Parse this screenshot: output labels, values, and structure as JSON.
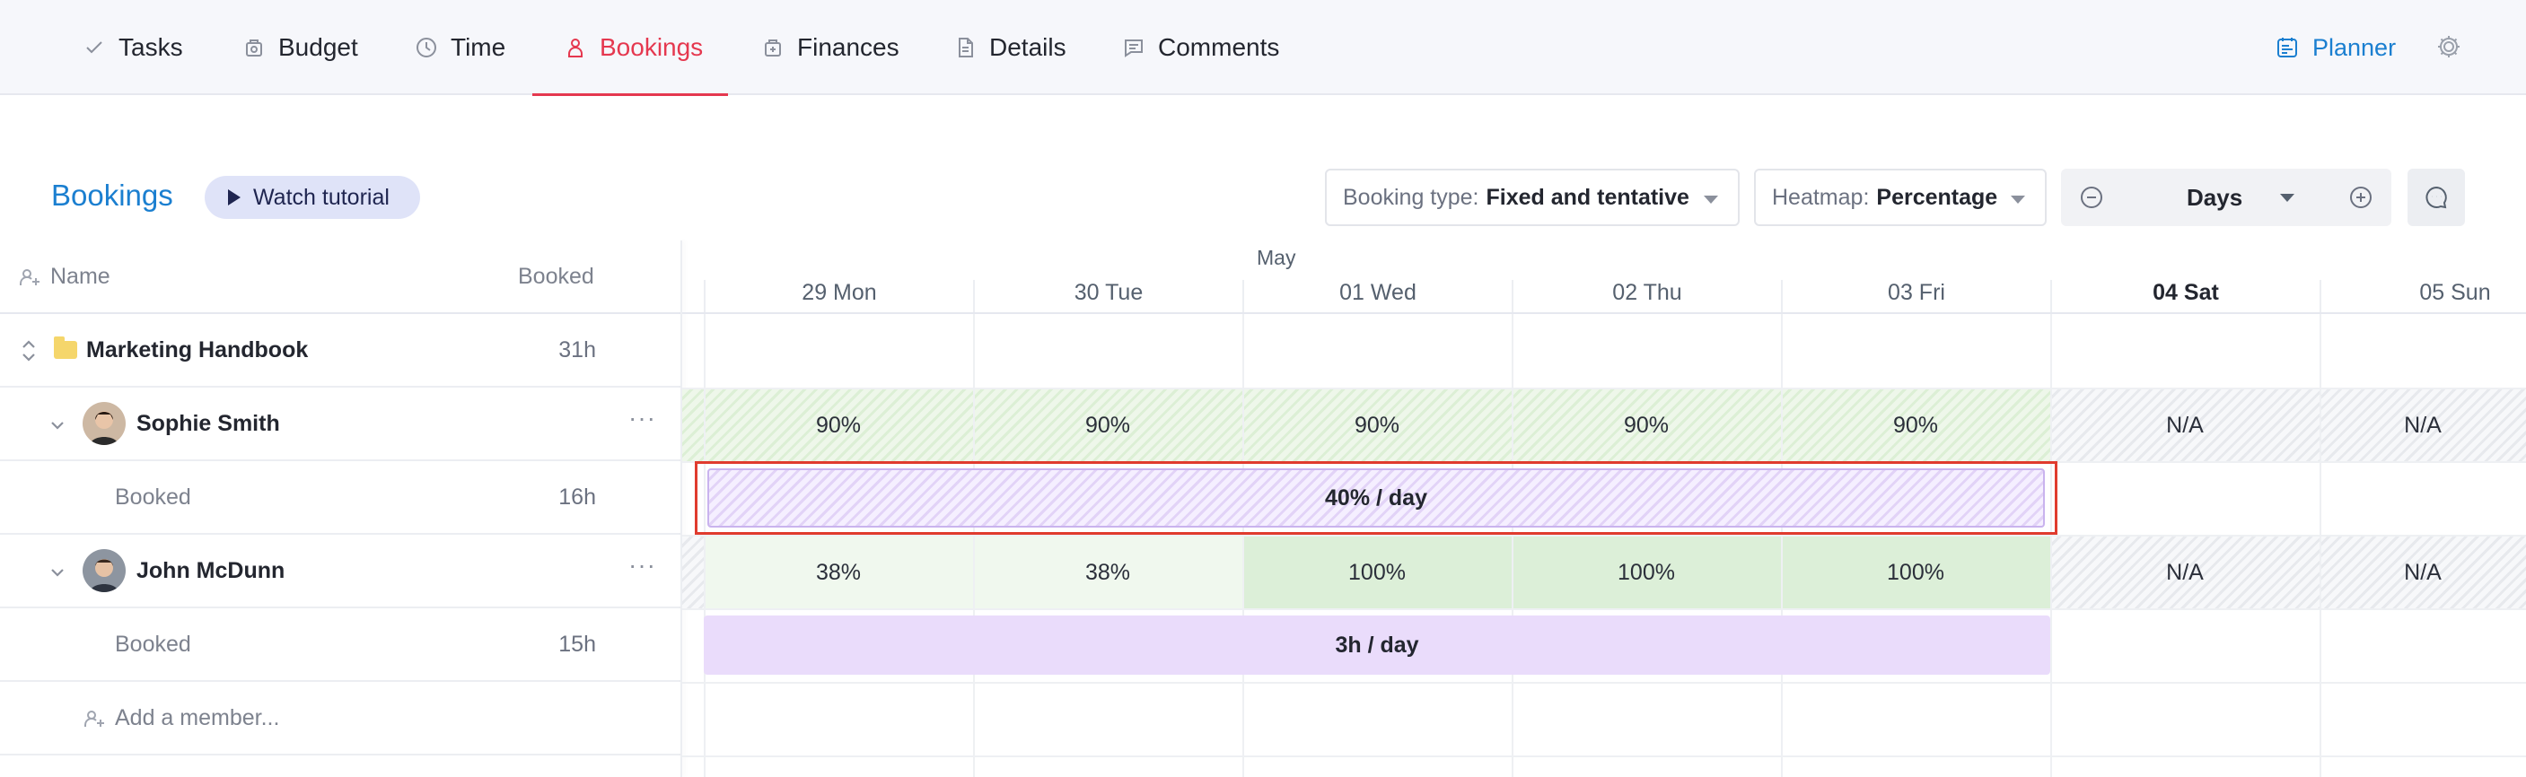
{
  "tabs": [
    {
      "label": "Tasks",
      "icon": "check-icon",
      "active": false
    },
    {
      "label": "Budget",
      "icon": "budget-icon",
      "active": false
    },
    {
      "label": "Time",
      "icon": "clock-icon",
      "active": false
    },
    {
      "label": "Bookings",
      "icon": "person-icon",
      "active": true
    },
    {
      "label": "Finances",
      "icon": "finances-icon",
      "active": false
    },
    {
      "label": "Details",
      "icon": "document-icon",
      "active": false
    },
    {
      "label": "Comments",
      "icon": "comment-icon",
      "active": false
    }
  ],
  "topbar": {
    "planner_label": "Planner"
  },
  "toolbar": {
    "title": "Bookings",
    "tutorial_label": "Watch tutorial",
    "booking_type_label": "Booking type:",
    "booking_type_value": "Fixed and tentative",
    "heatmap_label": "Heatmap:",
    "heatmap_value": "Percentage",
    "zoom_value": "Days"
  },
  "table": {
    "name_header": "Name",
    "booked_header": "Booked",
    "rows": [
      {
        "type": "project",
        "label": "Marketing Handbook",
        "hours": "31h"
      },
      {
        "type": "member",
        "label": "Sophie Smith",
        "hours": ""
      },
      {
        "type": "booking",
        "label": "Booked",
        "hours": "16h"
      },
      {
        "type": "member",
        "label": "John McDunn",
        "hours": ""
      },
      {
        "type": "booking",
        "label": "Booked",
        "hours": "15h"
      },
      {
        "type": "add",
        "label": "Add a member...",
        "hours": ""
      }
    ]
  },
  "calendar": {
    "month_label": "May",
    "days": [
      "29 Mon",
      "30 Tue",
      "01 Wed",
      "02 Thu",
      "03 Fri",
      "04 Sat",
      "05 Sun"
    ],
    "sophie_heat": [
      "90%",
      "90%",
      "90%",
      "90%",
      "90%",
      "N/A",
      "N/A"
    ],
    "sophie_booking": "40% / day",
    "john_heat": [
      "38%",
      "38%",
      "100%",
      "100%",
      "100%",
      "N/A",
      "N/A"
    ],
    "john_booking": "3h / day"
  },
  "colors": {
    "accent_active": "#e5384f",
    "brand_blue": "#1b7fd0",
    "heat_green": "#dcefd8",
    "booking_purple": "#eadcfb",
    "highlight_red": "#e03b2e"
  }
}
